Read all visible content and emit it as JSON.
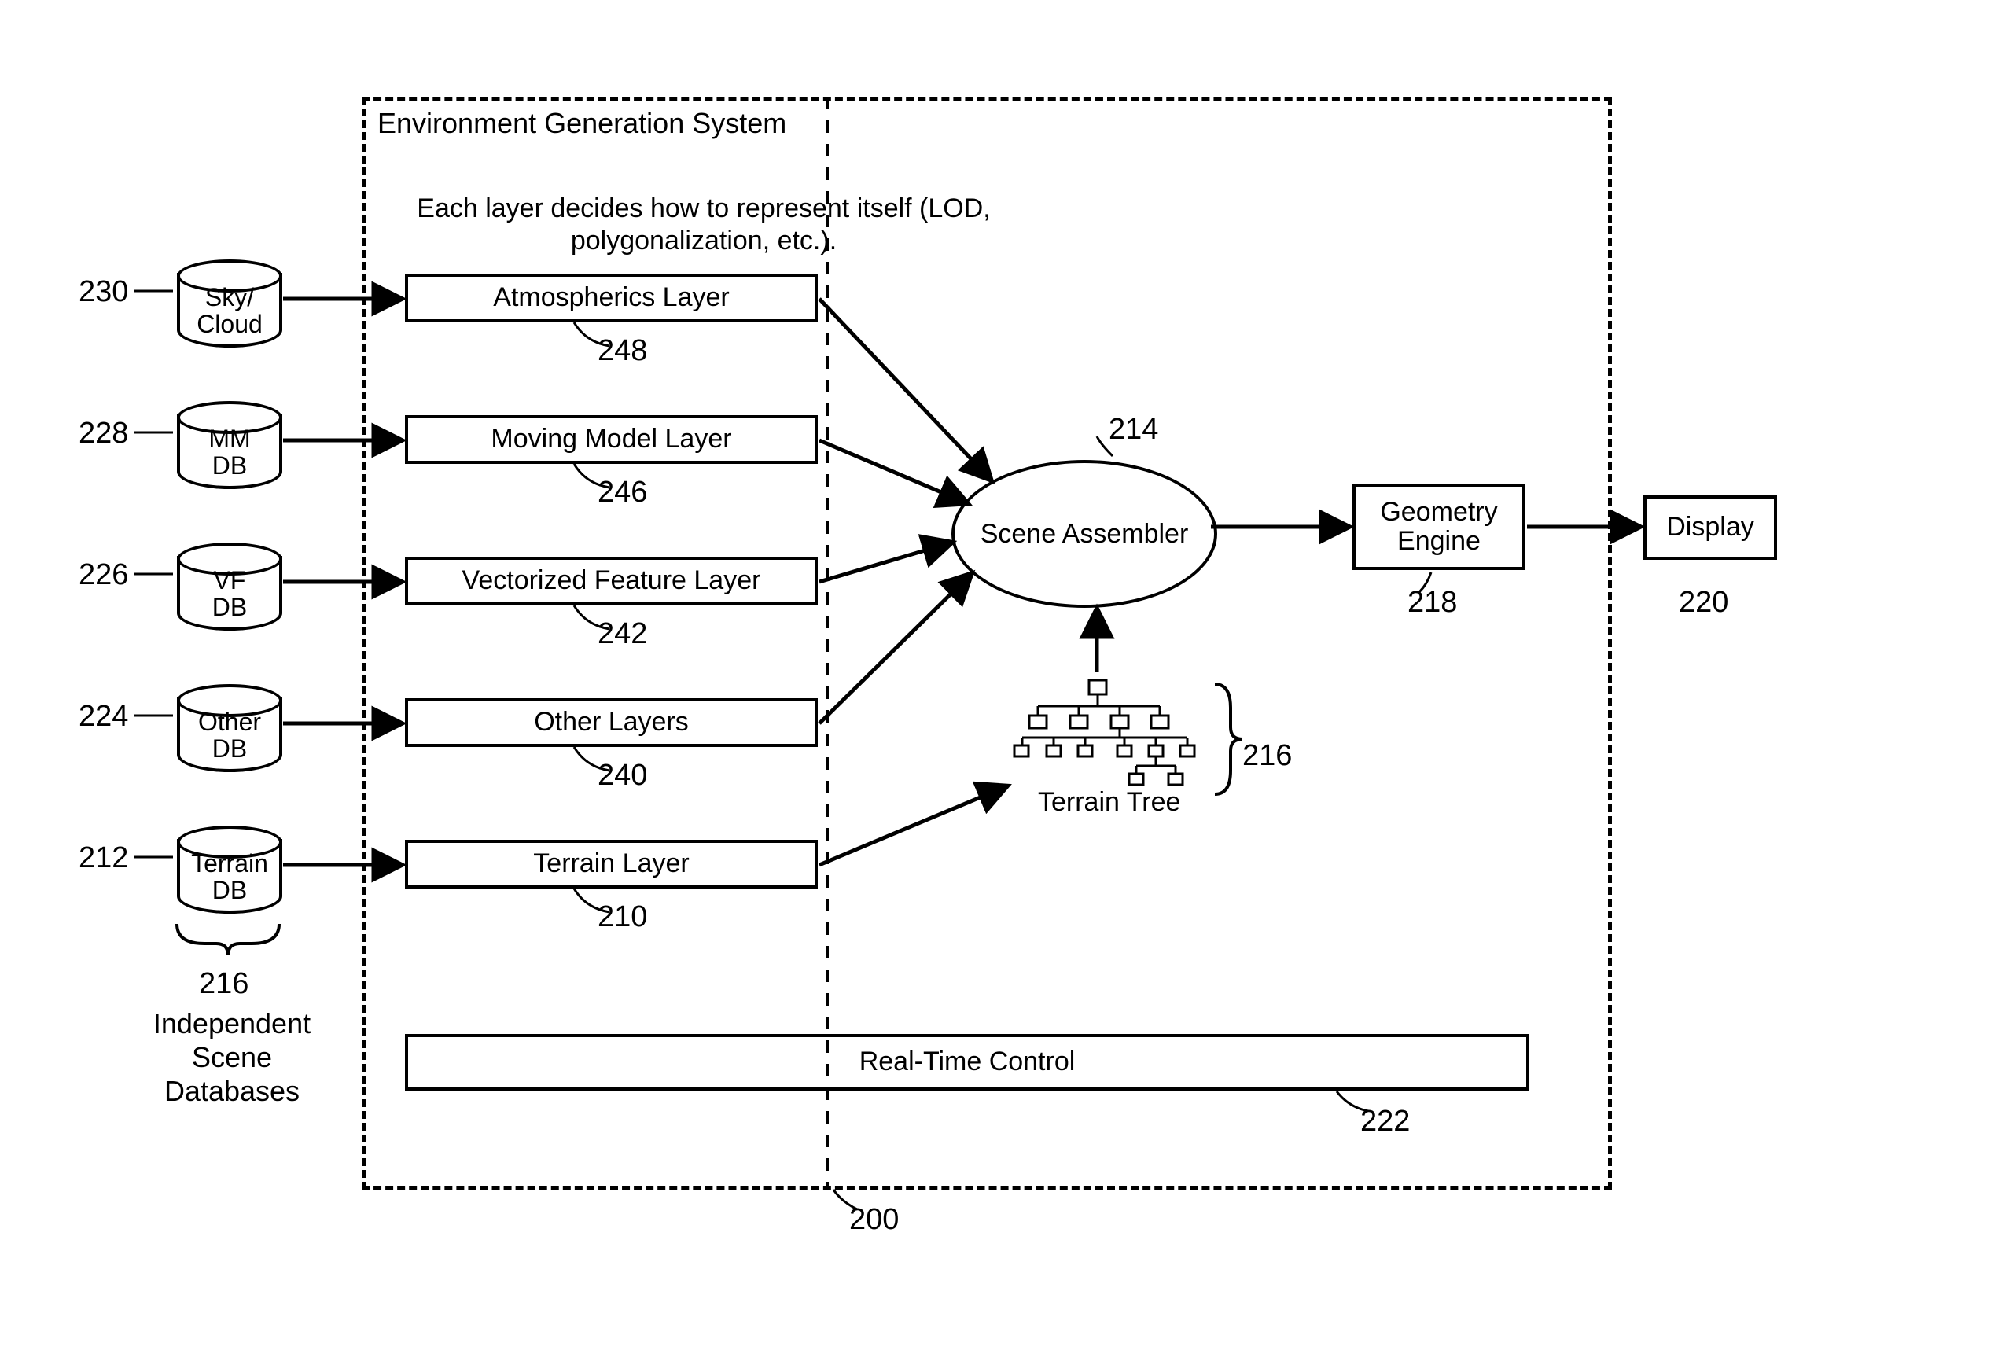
{
  "frame_title": "Environment Generation System",
  "note": "Each layer decides how to represent itself (LOD, polygonalization, etc.).",
  "dbs": {
    "sky": {
      "label": "Sky/\nCloud",
      "ref": "230"
    },
    "mm": {
      "label": "MM\nDB",
      "ref": "228"
    },
    "vf": {
      "label": "VF\nDB",
      "ref": "226"
    },
    "other": {
      "label": "Other\nDB",
      "ref": "224"
    },
    "terrain": {
      "label": "Terrain\nDB",
      "ref": "212"
    }
  },
  "db_group": {
    "ref": "216",
    "label": "Independent\nScene\nDatabases"
  },
  "layers": {
    "atmos": {
      "label": "Atmospherics Layer",
      "ref": "248"
    },
    "moving": {
      "label": "Moving Model Layer",
      "ref": "246"
    },
    "vect": {
      "label": "Vectorized Feature Layer",
      "ref": "242"
    },
    "other": {
      "label": "Other Layers",
      "ref": "240"
    },
    "terrain": {
      "label": "Terrain Layer",
      "ref": "210"
    }
  },
  "assembler": {
    "label": "Scene Assembler",
    "ref": "214"
  },
  "tree": {
    "label": "Terrain Tree",
    "ref": "216"
  },
  "realtime": {
    "label": "Real-Time Control",
    "ref": "222"
  },
  "geom": {
    "label": "Geometry\nEngine",
    "ref": "218"
  },
  "display": {
    "label": "Display",
    "ref": "220"
  },
  "frame_ref": "200"
}
